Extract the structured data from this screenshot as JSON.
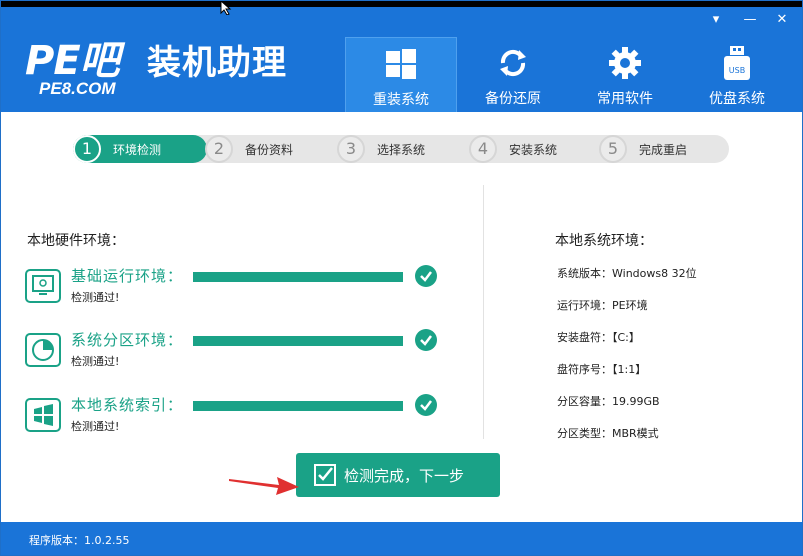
{
  "app": {
    "logo_main": "PE吧",
    "logo_sub": "PE8.COM",
    "logo_cn": "装机助理"
  },
  "window_controls": [
    {
      "name": "menu-dropdown-icon",
      "glyph": "▾"
    },
    {
      "name": "minimize-icon",
      "glyph": "—"
    },
    {
      "name": "close-icon",
      "glyph": "✕"
    }
  ],
  "nav": {
    "items": [
      {
        "label": "重装系统",
        "icon": "windows-icon",
        "active": true
      },
      {
        "label": "备份还原",
        "icon": "refresh-icon",
        "active": false
      },
      {
        "label": "常用软件",
        "icon": "gear-icon",
        "active": false
      },
      {
        "label": "优盘系统",
        "icon": "usb-icon",
        "active": false
      }
    ]
  },
  "steps": [
    {
      "num": "1",
      "label": "环境检测",
      "active": true
    },
    {
      "num": "2",
      "label": "备份资料",
      "active": false
    },
    {
      "num": "3",
      "label": "选择系统",
      "active": false
    },
    {
      "num": "4",
      "label": "安装系统",
      "active": false
    },
    {
      "num": "5",
      "label": "完成重启",
      "active": false
    }
  ],
  "hardware": {
    "title": "本地硬件环境：",
    "checks": [
      {
        "name": "基础运行环境：",
        "status": "检测通过!",
        "icon": "monitor-icon",
        "progress": 1.0
      },
      {
        "name": "系统分区环境：",
        "status": "检测通过!",
        "icon": "pie-chart-icon",
        "progress": 1.0
      },
      {
        "name": "本地系统索引：",
        "status": "检测通过!",
        "icon": "windows-logo-icon",
        "progress": 1.0
      }
    ]
  },
  "system": {
    "title": "本地系统环境：",
    "rows": [
      {
        "label": "系统版本：",
        "value": "Windows8  32位"
      },
      {
        "label": "运行环境：",
        "value": "PE环境"
      },
      {
        "label": "安装盘符：",
        "value": "【C:】"
      },
      {
        "label": "盘符序号：",
        "value": "【1:1】"
      },
      {
        "label": "分区容量：",
        "value": "19.99GB"
      },
      {
        "label": "分区类型：",
        "value": "MBR模式"
      }
    ]
  },
  "action": {
    "next_label": "检测完成，下一步"
  },
  "footer": {
    "version": "程序版本：1.0.2.55"
  },
  "colors": {
    "header_blue": "#1a74d8",
    "accent_green": "#1aa287",
    "arrow_red": "#e03030"
  }
}
